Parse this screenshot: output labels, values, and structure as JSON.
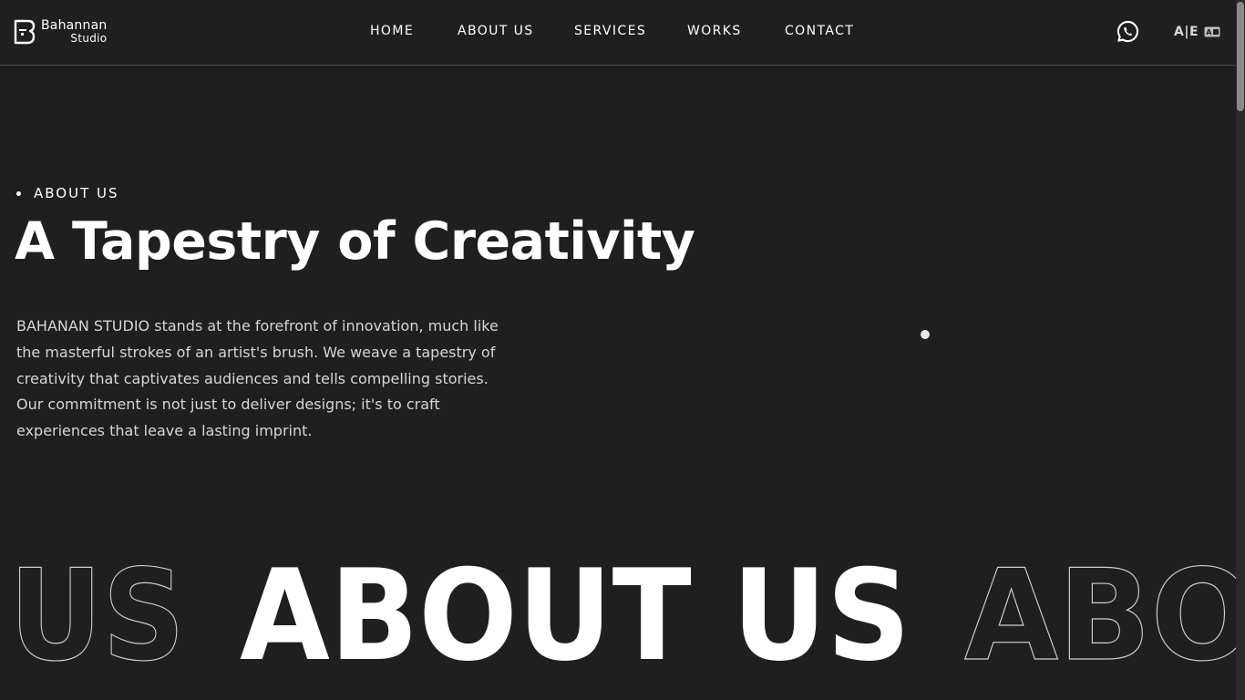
{
  "brand": {
    "name_line1": "Bahannan",
    "name_line2": "Studio"
  },
  "nav": {
    "items": [
      {
        "label": "HOME"
      },
      {
        "label": "ABOUT US"
      },
      {
        "label": "SERVICES"
      },
      {
        "label": "WORKS"
      },
      {
        "label": "CONTACT"
      }
    ]
  },
  "header_actions": {
    "whatsapp_icon": "whatsapp-icon",
    "language_label": "A|E",
    "language_icon": "translate-icon"
  },
  "hero": {
    "eyebrow": "ABOUT US",
    "title": "A Tapestry of Creativity",
    "body": "BAHANAN STUDIO stands at the forefront of innovation, much like the masterful strokes of an artist's brush. We weave a tapestry of creativity that captivates audiences and tells compelling stories. Our commitment is not just to deliver designs; it's to craft experiences that leave a lasting imprint."
  },
  "marquee": {
    "left_outline": "US",
    "solid": "ABOUT US",
    "right_outline": "ABO"
  },
  "colors": {
    "background": "#1f1f1f",
    "text": "#ffffff",
    "muted_text": "#d6d6d6",
    "divider": "#4a4a4a"
  }
}
